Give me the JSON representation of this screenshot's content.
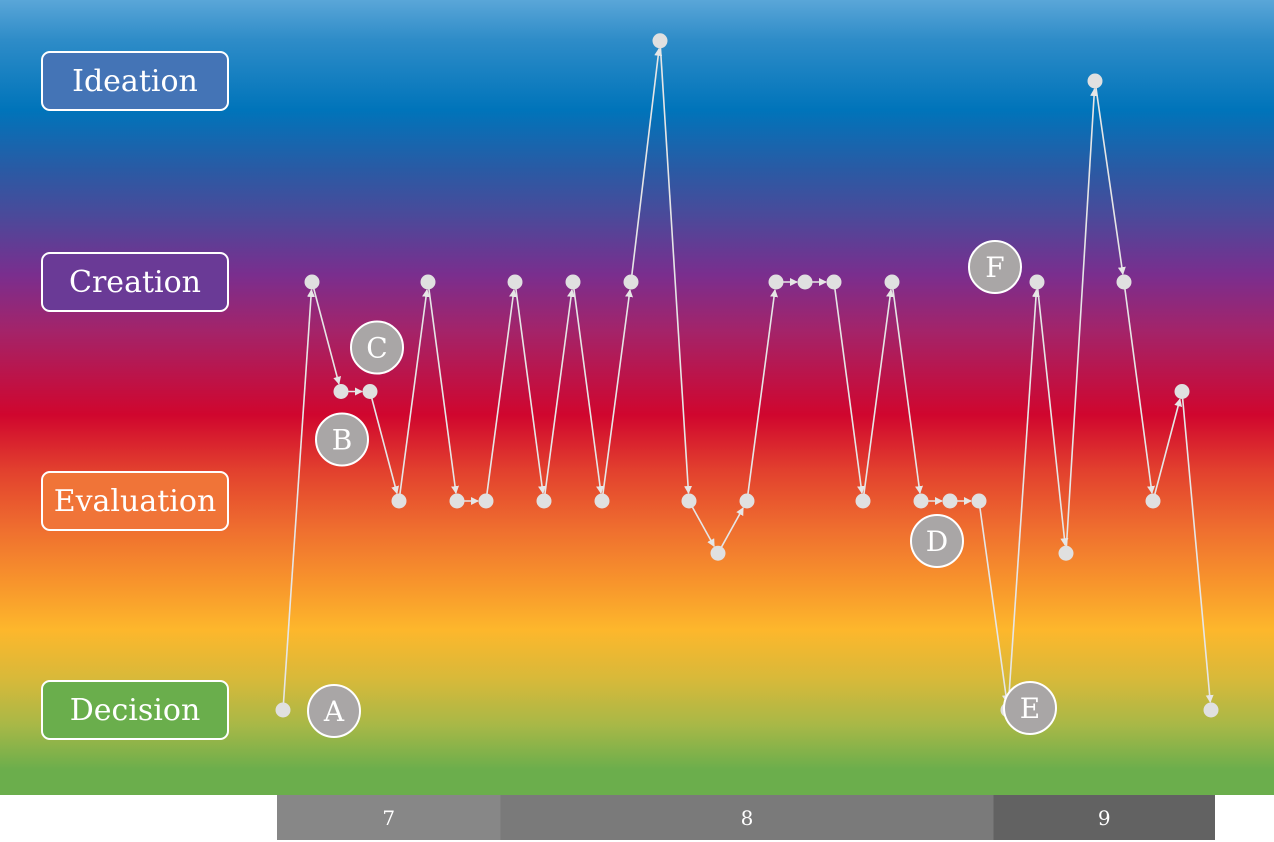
{
  "levels": [
    {
      "label": "Ideation",
      "fill": "#4474b6"
    },
    {
      "label": "Creation",
      "fill": "#6a3a96"
    },
    {
      "label": "Evaluation",
      "fill": "#f07438"
    },
    {
      "label": "Decision",
      "fill": "#6aae4c"
    }
  ],
  "chart_data": {
    "type": "line",
    "y_scale": "categorical levels: 0 = Decision, 1 = Evaluation, 2 = Creation, 3 = Ideation",
    "points": [
      0,
      2,
      1.5,
      1.5,
      1,
      2,
      1,
      1,
      2,
      1,
      2,
      1,
      2,
      3.2,
      1,
      0.75,
      1,
      2,
      2,
      2,
      1,
      2,
      1,
      1,
      1,
      0,
      2,
      0.75,
      3,
      2,
      1,
      1.5,
      0
    ],
    "annotations": [
      {
        "label": "A",
        "point": 1
      },
      {
        "label": "B",
        "point": 3
      },
      {
        "label": "C",
        "point": 4
      },
      {
        "label": "D",
        "point": 24
      },
      {
        "label": "E",
        "point": 26
      },
      {
        "label": "F",
        "point": 27
      }
    ],
    "segments": [
      {
        "label": "7",
        "first_point": 1,
        "last_point": 8,
        "fill": "#878787"
      },
      {
        "label": "8",
        "first_point": 9,
        "last_point": 25,
        "fill": "#7a7a7a"
      },
      {
        "label": "9",
        "first_point": 26,
        "last_point": 33,
        "fill": "#626262"
      }
    ],
    "colors": {
      "line": "#e6e6e6",
      "point": "#e0e0e0",
      "annotation_fill": "#a9a6a6"
    }
  }
}
